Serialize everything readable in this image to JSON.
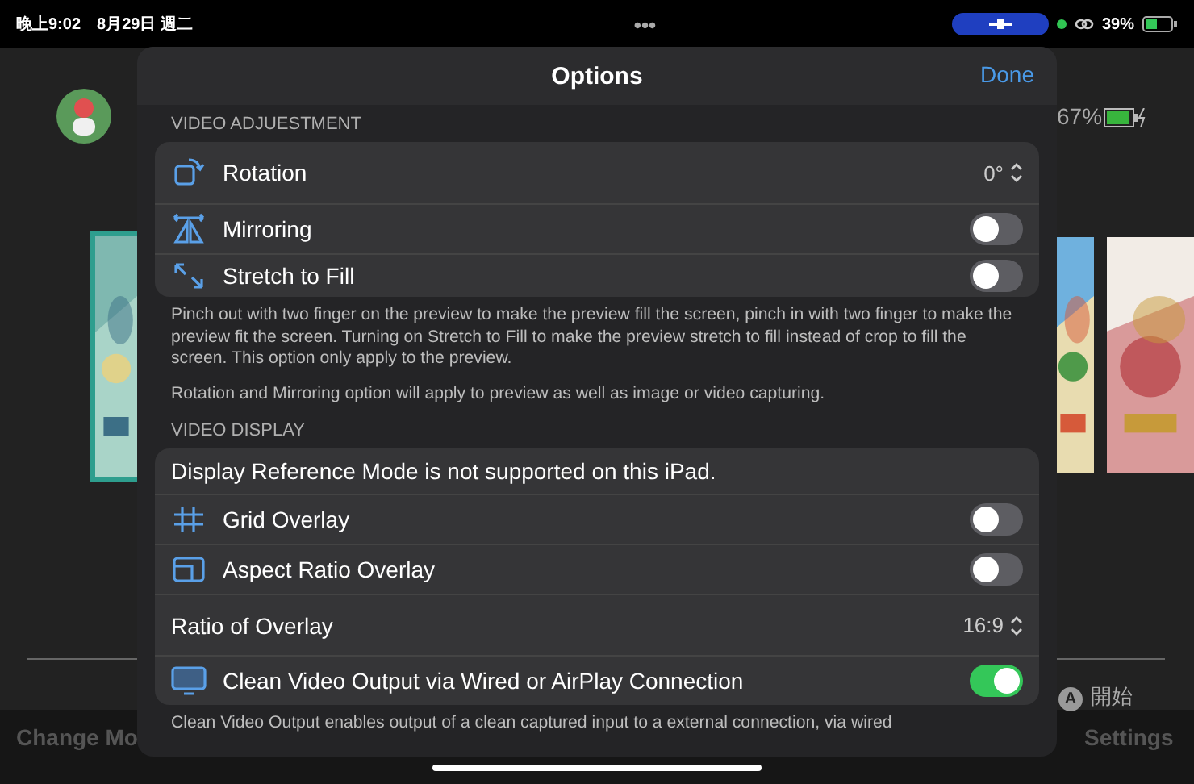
{
  "status_bar": {
    "time": "晚上9:02",
    "date": "8月29日 週二",
    "dots": "•••",
    "battery": "39%"
  },
  "background": {
    "battery": "67%",
    "start_key": "A",
    "start_label": "開始",
    "left_action": "Change Mo",
    "right_action": "Settings"
  },
  "sheet": {
    "title": "Options",
    "done": "Done",
    "sections": [
      {
        "header": "VIDEO ADJUESTMENT",
        "rows": [
          {
            "kind": "picker",
            "label": "Rotation",
            "value": "0°"
          },
          {
            "kind": "toggle",
            "label": "Mirroring",
            "on": false
          },
          {
            "kind": "toggle",
            "label": "Stretch to Fill",
            "on": false
          }
        ],
        "footer": [
          "Pinch out with two finger on the preview to make the preview fill the screen, pinch in with two finger to make the preview fit the screen. Turning on Stretch to Fill to make the preview stretch to fill instead of crop to fill the screen. This option only apply to the preview.",
          "Rotation and Mirroring option will apply to preview as well as image or video capturing."
        ]
      },
      {
        "header": "VIDEO DISPLAY",
        "rows": [
          {
            "kind": "note",
            "label": "Display Reference Mode is not supported on this iPad."
          },
          {
            "kind": "toggle",
            "label": "Grid Overlay",
            "on": false
          },
          {
            "kind": "toggle",
            "label": "Aspect Ratio Overlay",
            "on": false
          },
          {
            "kind": "picker",
            "label": "Ratio of Overlay",
            "value": "16:9"
          },
          {
            "kind": "toggle",
            "label": "Clean Video Output via Wired or AirPlay Connection",
            "on": true
          }
        ],
        "footer": [
          "Clean Video Output enables output of a clean captured input to a external connection, via wired"
        ]
      }
    ]
  }
}
